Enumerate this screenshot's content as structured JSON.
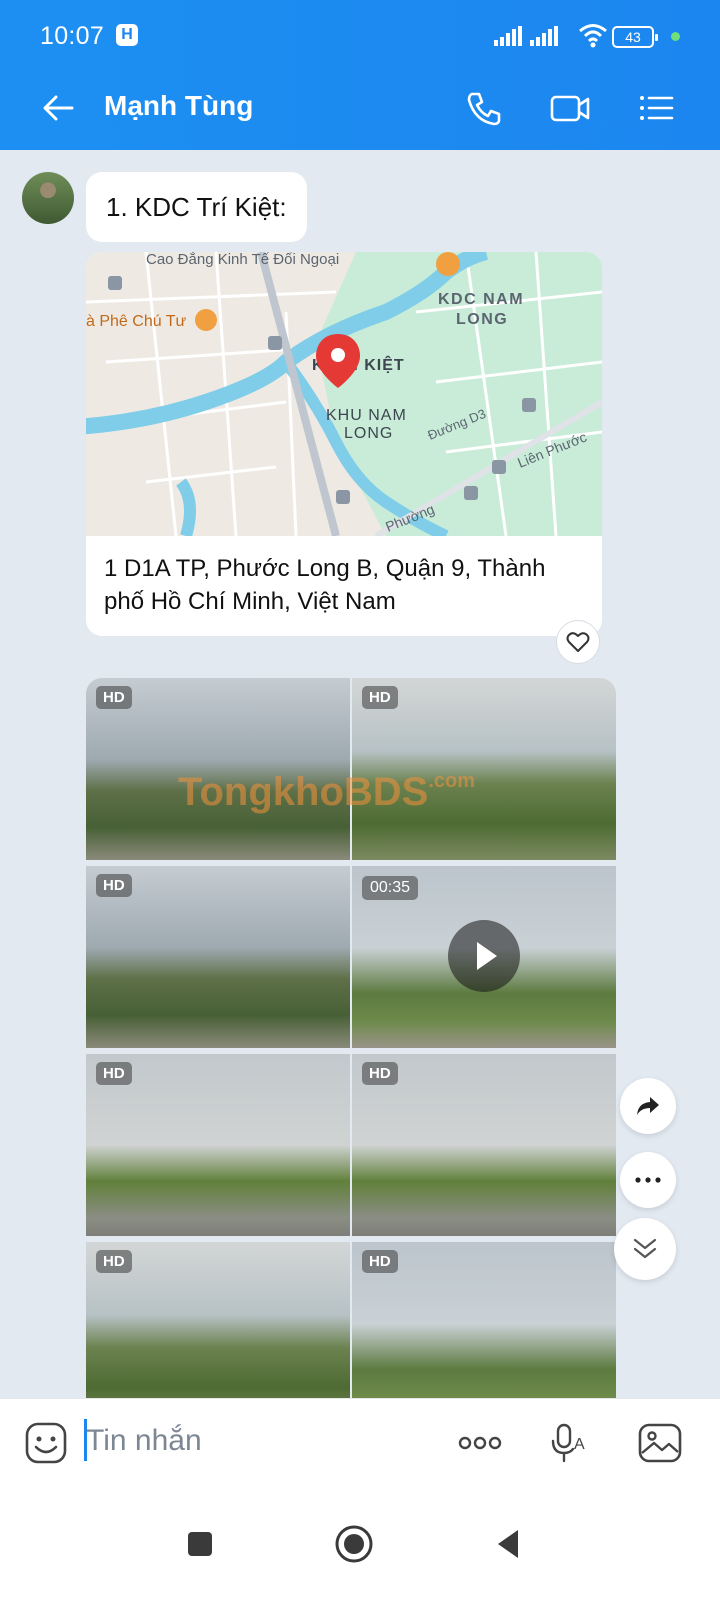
{
  "status_bar": {
    "time": "10:07",
    "app_badge": "H",
    "battery": "43"
  },
  "header": {
    "contact_name": "Mạnh Tùng"
  },
  "messages": {
    "text": "1. KDC Trí Kiệt:",
    "location": {
      "address": "1 D1A TP, Phước Long B, Quận 9, Thành phố Hồ Chí Minh, Việt Nam",
      "map_labels": {
        "top_label": "Cao Đẳng Kinh Tế Đối Ngoại",
        "cafe": "à Phê Chú Tư",
        "kdc_nam_long_1": "KDC NAM",
        "kdc_nam_long_2": "LONG",
        "pin_label": "K   TRÍ KIỆT",
        "khu_nam_long_1": "KHU NAM",
        "khu_nam_long_2": "LONG",
        "road_d3": "Đường D3",
        "road_lien_phuoc": "Liên Phước",
        "road_phuong": "Phường"
      }
    },
    "media": [
      {
        "badge": "HD"
      },
      {
        "badge": "HD"
      },
      {
        "badge": "HD"
      },
      {
        "badge": "00:35"
      },
      {
        "badge": "HD"
      },
      {
        "badge": "HD"
      },
      {
        "badge": "HD"
      },
      {
        "badge": "HD"
      }
    ],
    "watermark": "TongkhoBDS",
    "watermark_suffix": ".com"
  },
  "composer": {
    "placeholder": "Tin nhắn"
  },
  "icons": {
    "back": "arrow-left-icon",
    "call": "phone-icon",
    "video": "video-call-icon",
    "menu": "list-menu-icon",
    "emoji": "emoji-icon",
    "more": "more-horizontal-icon",
    "voice": "voice-to-text-icon",
    "image": "image-icon",
    "share": "share-arrow-icon",
    "options": "options-icon",
    "scroll_down": "scroll-down-icon",
    "like": "heart-icon",
    "play": "play-icon"
  },
  "colors": {
    "accent": "#1b86ef",
    "background": "#e2e9f1",
    "bubble": "#ffffff"
  }
}
